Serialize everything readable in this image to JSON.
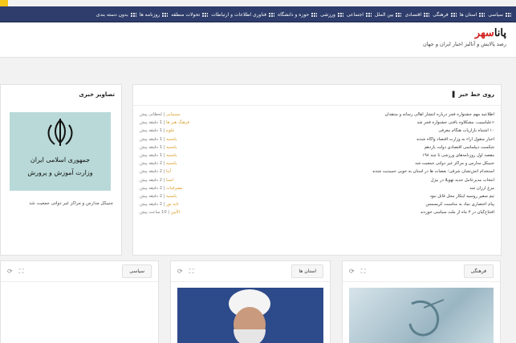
{
  "nav": {
    "items": [
      "سیاسی",
      "استان ها",
      "فرهنگی",
      "اقتصادی",
      "بین الملل",
      "اجتماعی",
      "ورزشی",
      "حوزه و دانشگاه",
      "فناوری اطلاعات و ارتباطات",
      "تحولات منطقه",
      "روزنامه ها",
      "بدون دسته بندی"
    ]
  },
  "header": {
    "logo_main": "پانا",
    "logo_accent": "سهر",
    "tagline": "رصد پالایش و آنالیز اخبار ایران و جهان"
  },
  "news_panel": {
    "title": "روی خط خبر",
    "items": [
      {
        "title": "اطلاعیه مهم جشنواره فجر درباره انتشار اهالی رسانه و منتقدان",
        "category": "سینمایی",
        "time": "لحظاتی پیش"
      },
      {
        "title": "«علیاسیب، مشکلاوه بافتی جشنواره فجر شد",
        "category": "فرهنگ هنر ها",
        "time": "1 دقیقه پیش"
      },
      {
        "title": "۱۰ اشتباه بازاریاب هنگام معرفی",
        "category": "علوم",
        "time": "1 دقیقه پیش"
      },
      {
        "title": "اخبار متقول آراء به وزارت اقتصاد وآگاه شدند",
        "category": "یاستیه",
        "time": "1 دقیقه پیش"
      },
      {
        "title": "شکست دیپلماسی اقتصادی دولت یازدهم",
        "category": "یاستیه",
        "time": "1 دقیقه پیش"
      },
      {
        "title": "مقصد اول روزنامه‌های ورزشی تا چند ۱۹۸",
        "category": "یاستیه",
        "time": "1 دقیقه پیش"
      },
      {
        "title": "جنیبکل مدارس و مراکز غیر دولتی جمعیت شد",
        "category": "یاستیه",
        "time": "2 دقیقه پیش"
      },
      {
        "title": "استخدام آتش‌نشان شرقی؛ بعضات ها در استان به خوبی حمیدیت شدند",
        "category": "آیتا",
        "time": "2 دقیقه پیش"
      },
      {
        "title": "انتخاب مدیرعامل جدید تهویلا در بیژل",
        "category": "استا",
        "time": "2 دقیقه پیش"
      },
      {
        "title": "مرغ ارزان شد",
        "category": "مصرفیات",
        "time": "2 دقیقه پیش"
      },
      {
        "title": "تیم سفیر روسیه اینکار محل قاتل نبود",
        "category": "یاستیه",
        "time": "2 دقیقه پیش"
      },
      {
        "title": "پیام اختصاری بنیاد به مناسبت کریسمس",
        "category": "تابه نور",
        "time": "2 دقیقه پیش"
      },
      {
        "title": "افتتاح‌گیان در ۳ ماه از ملت سیاسی خوردند",
        "category": "الأیین",
        "time": "10 ساعت پیش"
      }
    ]
  },
  "photo_panel": {
    "title": "تصاویر خبری",
    "image_text_1": "جمهوری اسلامی ایران",
    "image_text_2": "وزارت آموزش و پرورش",
    "caption": "جنیبکل مدارس و مراکز غیر دولتی جمعیت شد"
  },
  "cards": [
    {
      "label": "فرهنگی",
      "refresh": "⟳",
      "expand": "⛶"
    },
    {
      "label": "استان ها",
      "refresh": "⟳",
      "expand": "⛶"
    },
    {
      "label": "سیاسی",
      "refresh": "⟳",
      "expand": "⛶"
    }
  ],
  "colors": {
    "nav_bg": "#2e3d6b",
    "accent": "#d21f1f",
    "category": "#d89a21",
    "photo_bg": "#b8d9d7"
  }
}
